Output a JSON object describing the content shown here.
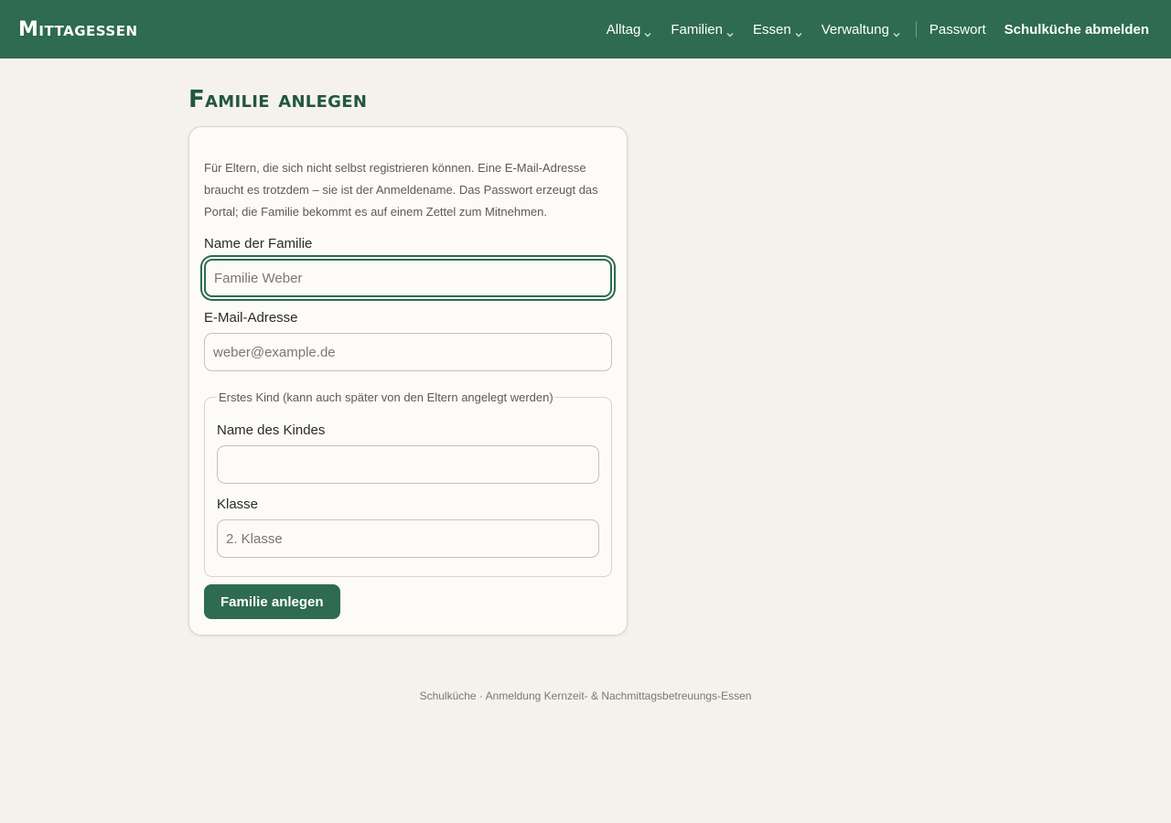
{
  "header": {
    "brand": "Mittagessen",
    "nav": [
      {
        "label": "Alltag",
        "dropdown": true,
        "icon": "chevron-down-icon"
      },
      {
        "label": "Familien",
        "dropdown": true,
        "icon": "chevron-down-icon"
      },
      {
        "label": "Essen",
        "dropdown": true,
        "icon": "chevron-down-icon"
      },
      {
        "label": "Verwaltung",
        "dropdown": true,
        "icon": "chevron-down-icon"
      }
    ],
    "password_link": "Passwort",
    "logout_link": "Schulküche abmelden"
  },
  "main": {
    "title": "Familie anlegen",
    "intro": "Für Eltern, die sich nicht selbst registrieren können. Eine E-Mail-Adresse braucht es trotzdem – sie ist der Anmeldename. Das Passwort erzeugt das Portal; die Familie bekommt es auf einem Zettel zum Mitnehmen.",
    "form": {
      "family_name": {
        "label": "Name der Familie",
        "value": "",
        "placeholder": "Familie Weber"
      },
      "email": {
        "label": "E-Mail-Adresse",
        "value": "",
        "placeholder": "weber@example.de"
      },
      "first_child": {
        "legend": "Erstes Kind (kann auch später von den Eltern angelegt werden)",
        "child_name": {
          "label": "Name des Kindes",
          "value": "",
          "placeholder": ""
        },
        "class": {
          "label": "Klasse",
          "value": "",
          "placeholder": "2. Klasse"
        }
      },
      "submit_label": "Familie anlegen"
    }
  },
  "footer": {
    "text": "Schulküche · Anmeldung Kernzeit- & Nachmittagsbetreuungs-Essen"
  },
  "colors": {
    "brand_green": "#2e6b50",
    "title_green": "#22573f",
    "page_background": "#f5f2ec",
    "card_background": "#fdfbf7"
  }
}
